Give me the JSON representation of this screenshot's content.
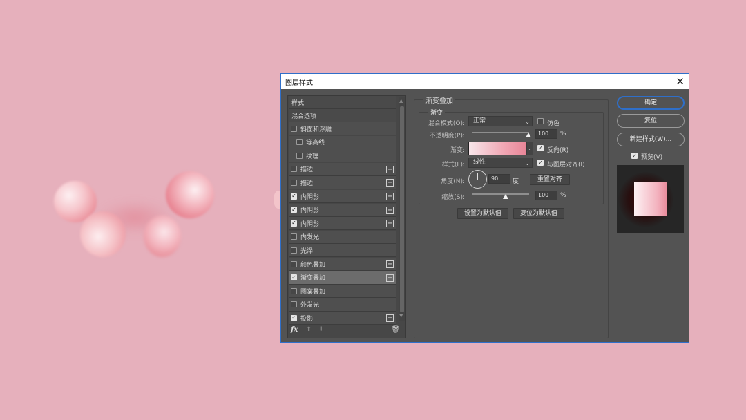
{
  "canvas": {
    "background": "#e6b0bc"
  },
  "dialog": {
    "title": "图层样式",
    "close_icon": "close-icon",
    "style_list": {
      "header": "样式",
      "blend_options": "混合选项",
      "items": [
        {
          "label": "斜面和浮雕",
          "checked": false,
          "plus": false,
          "indent": false
        },
        {
          "label": "等高线",
          "checked": false,
          "plus": false,
          "indent": true
        },
        {
          "label": "纹理",
          "checked": false,
          "plus": false,
          "indent": true
        },
        {
          "label": "描边",
          "checked": false,
          "plus": true,
          "indent": false
        },
        {
          "label": "描边",
          "checked": false,
          "plus": true,
          "indent": false
        },
        {
          "label": "内阴影",
          "checked": true,
          "plus": true,
          "indent": false
        },
        {
          "label": "内阴影",
          "checked": true,
          "plus": true,
          "indent": false
        },
        {
          "label": "内阴影",
          "checked": true,
          "plus": true,
          "indent": false
        },
        {
          "label": "内发光",
          "checked": false,
          "plus": false,
          "indent": false
        },
        {
          "label": "光泽",
          "checked": false,
          "plus": false,
          "indent": false
        },
        {
          "label": "颜色叠加",
          "checked": false,
          "plus": true,
          "indent": false
        },
        {
          "label": "渐变叠加",
          "checked": true,
          "plus": true,
          "indent": false,
          "selected": true
        },
        {
          "label": "图案叠加",
          "checked": false,
          "plus": false,
          "indent": false
        },
        {
          "label": "外发光",
          "checked": false,
          "plus": false,
          "indent": false
        },
        {
          "label": "投影",
          "checked": true,
          "plus": true,
          "indent": false
        }
      ],
      "footer": {
        "fx": "fx",
        "up_icon": "arrow-up-icon",
        "down_icon": "arrow-down-icon",
        "trash_icon": "trash-icon"
      }
    },
    "gradient_overlay": {
      "title": "渐变叠加",
      "section": "渐变",
      "blend_mode_label": "混合模式(O):",
      "blend_mode_value": "正常",
      "dither_label": "仿色",
      "dither_checked": false,
      "opacity_label": "不透明度(P):",
      "opacity_value": "100",
      "opacity_unit": "%",
      "opacity_fraction": 1.0,
      "gradient_label": "渐变:",
      "reverse_label": "反向(R)",
      "reverse_checked": true,
      "style_label": "样式(L):",
      "style_value": "线性",
      "align_label": "与图层对齐(I)",
      "align_checked": true,
      "angle_label": "角度(N):",
      "angle_value": "90",
      "angle_unit": "度",
      "reset_align_button": "重置对齐",
      "scale_label": "缩放(S):",
      "scale_value": "100",
      "scale_unit": "%",
      "scale_fraction": 0.5,
      "set_default_button": "设置为默认值",
      "reset_default_button": "复位为默认值"
    },
    "actions": {
      "ok": "确定",
      "reset": "复位",
      "new_style": "新建样式(W)...",
      "preview_label": "预览(V)",
      "preview_checked": true
    }
  }
}
